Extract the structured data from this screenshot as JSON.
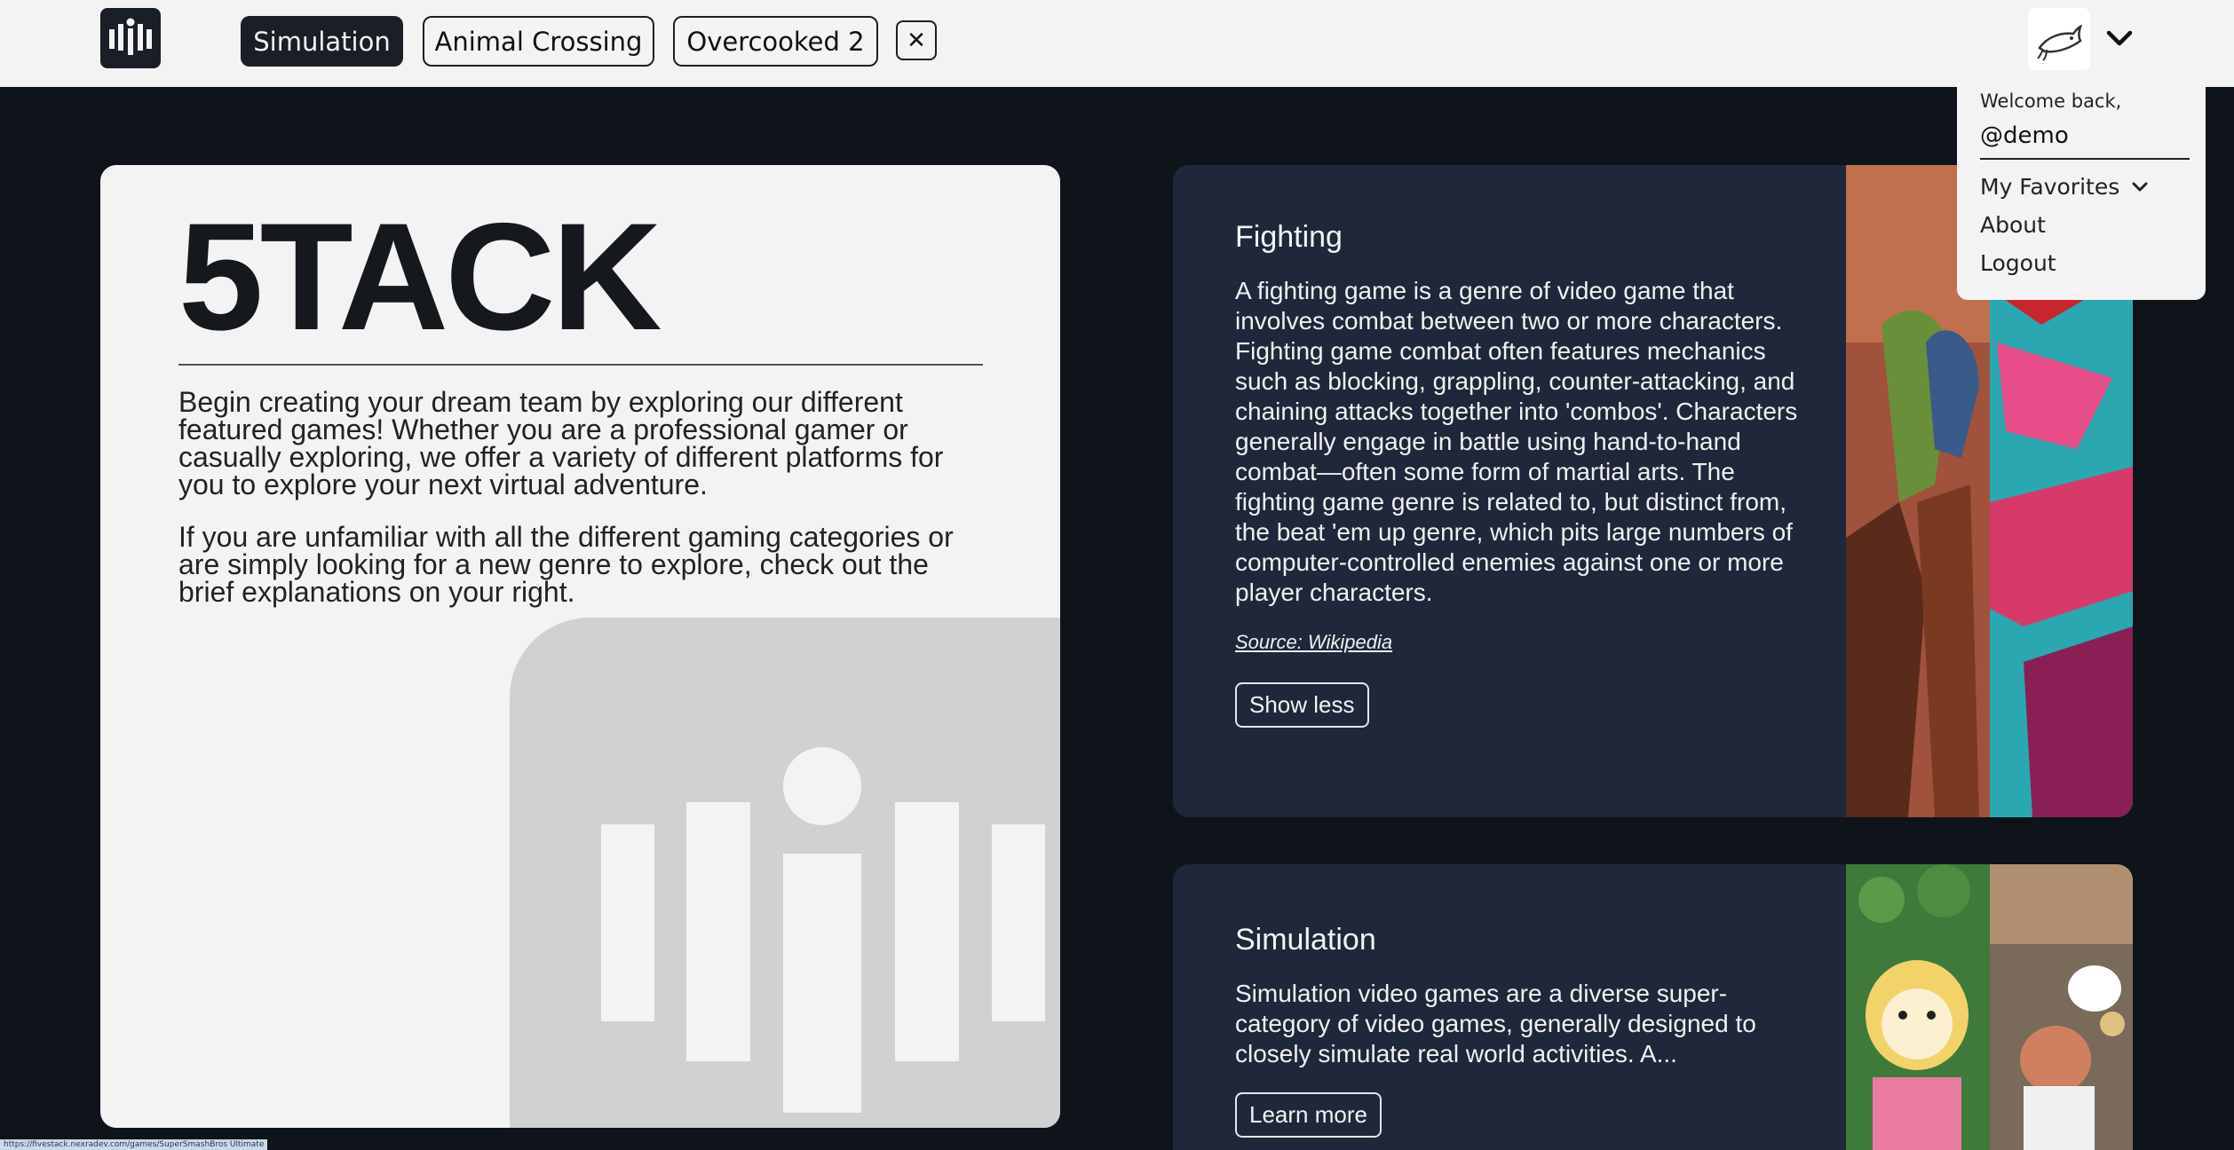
{
  "nav": {
    "logo_icon": "fivestack-logo-icon",
    "tabs": [
      {
        "label": "Simulation",
        "active": true
      },
      {
        "label": "Animal Crossing",
        "active": false
      },
      {
        "label": "Overcooked 2",
        "active": false
      }
    ],
    "close_tab_label": "✕",
    "avatar_icon": "fish-avatar-icon",
    "menu_chevron_icon": "chevron-down-icon"
  },
  "user_menu": {
    "welcome": "Welcome back,",
    "username": "@demo",
    "favorites_label": "My Favorites",
    "about_label": "About",
    "logout_label": "Logout"
  },
  "hero": {
    "title": "5TACK",
    "paragraph_1": "Begin creating your dream team by exploring our different featured games! Whether you are a professional gamer or casually exploring, we offer a variety of different platforms for you to explore your next virtual adventure.",
    "paragraph_2": "If you are unfamiliar with all the different gaming categories or are simply looking for a new genre to explore, check out the brief explanations on your right."
  },
  "categories": [
    {
      "title": "Fighting",
      "body": "A fighting game is a genre of video game that involves combat between two or more characters. Fighting game combat often features mechanics such as blocking, grappling, counter-attacking, and chaining attacks together into 'combos'. Characters generally engage in battle using hand-to-hand combat—often some form of martial arts. The fighting game genre is related to, but distinct from, the beat 'em up genre, which pits large numbers of computer-controlled enemies against one or more player characters.",
      "source": "Source: Wikipedia",
      "button": "Show less"
    },
    {
      "title": "Simulation",
      "body": "Simulation video games are a diverse super-category of video games, generally designed to closely simulate real world activities. A...",
      "button": "Learn more"
    }
  ],
  "status_url": "https://fivestack.nexradev.com/games/SuperSmashBros Ultimate",
  "colors": {
    "page_bg": "#0f141b",
    "topbar_bg": "#f3f3f3",
    "card_dark": "#1f283a",
    "card_light": "#f3f3f3",
    "accent_dark": "#1a1f27"
  }
}
